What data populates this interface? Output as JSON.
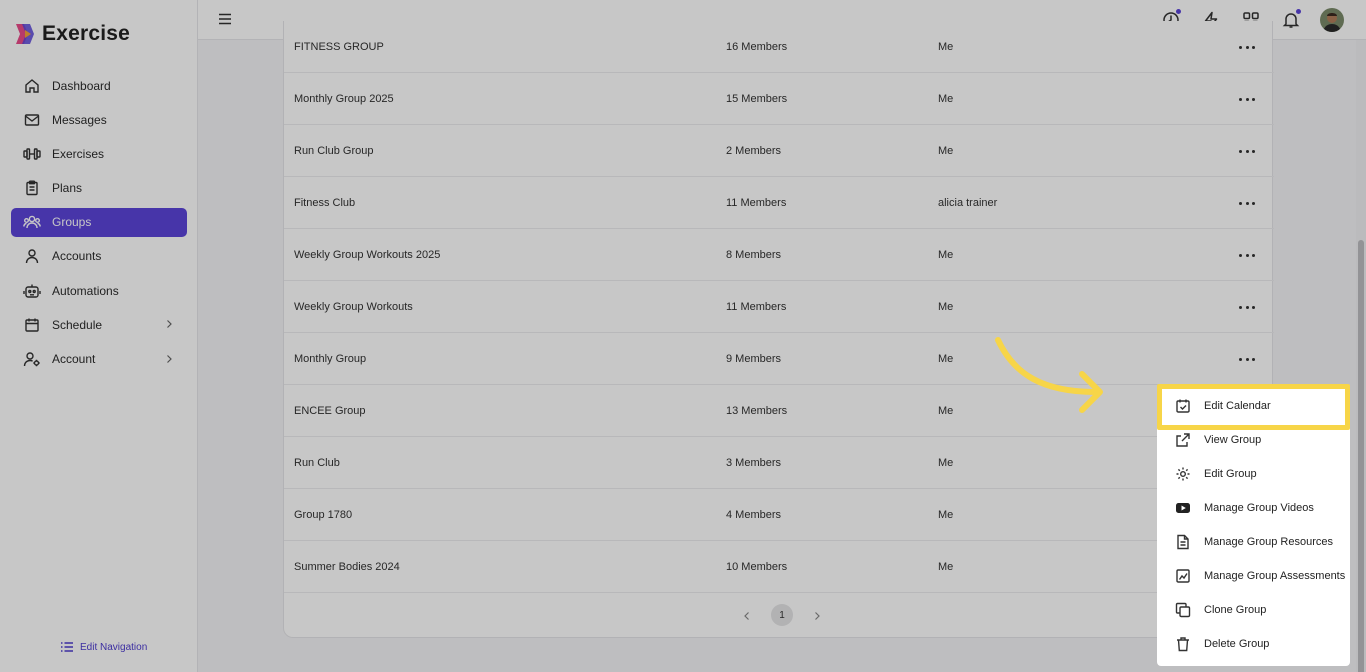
{
  "app": {
    "name": "Exercise"
  },
  "sidebar": {
    "items": [
      {
        "label": "Dashboard",
        "icon": "home-icon"
      },
      {
        "label": "Messages",
        "icon": "mail-icon"
      },
      {
        "label": "Exercises",
        "icon": "dumbbell-icon"
      },
      {
        "label": "Plans",
        "icon": "clipboard-icon"
      },
      {
        "label": "Groups",
        "icon": "users-icon",
        "active": true
      },
      {
        "label": "Accounts",
        "icon": "user-icon"
      },
      {
        "label": "Automations",
        "icon": "robot-icon"
      },
      {
        "label": "Schedule",
        "icon": "calendar-icon",
        "expandable": true
      },
      {
        "label": "Account",
        "icon": "user-gear-icon",
        "expandable": true
      }
    ],
    "edit_navigation": "Edit Navigation"
  },
  "topbar": {
    "icons": [
      "clock-icon",
      "lightning-icon",
      "grid-icon",
      "bell-icon"
    ]
  },
  "groups": {
    "rows": [
      {
        "name": "FITNESS GROUP",
        "members": "16 Members",
        "owner": "Me"
      },
      {
        "name": "Monthly Group 2025",
        "members": "15 Members",
        "owner": "Me"
      },
      {
        "name": "Run Club Group",
        "members": "2 Members",
        "owner": "Me"
      },
      {
        "name": "Fitness Club",
        "members": "11 Members",
        "owner": "alicia trainer"
      },
      {
        "name": "Weekly Group Workouts 2025",
        "members": "8 Members",
        "owner": "Me"
      },
      {
        "name": "Weekly Group Workouts",
        "members": "11 Members",
        "owner": "Me"
      },
      {
        "name": "Monthly Group",
        "members": "9 Members",
        "owner": "Me"
      },
      {
        "name": "ENCEE Group",
        "members": "13 Members",
        "owner": "Me"
      },
      {
        "name": "Run Club",
        "members": "3 Members",
        "owner": "Me"
      },
      {
        "name": "Group 1780",
        "members": "4 Members",
        "owner": "Me"
      },
      {
        "name": "Summer Bodies 2024",
        "members": "10 Members",
        "owner": "Me"
      }
    ],
    "pagination": {
      "current_page": "1"
    }
  },
  "context_menu": {
    "items": [
      {
        "label": "Edit Calendar",
        "icon": "calendar-check-icon"
      },
      {
        "label": "View Group",
        "icon": "external-link-icon"
      },
      {
        "label": "Edit Group",
        "icon": "gear-icon"
      },
      {
        "label": "Manage Group Videos",
        "icon": "youtube-icon"
      },
      {
        "label": "Manage Group Resources",
        "icon": "document-icon"
      },
      {
        "label": "Manage Group Assessments",
        "icon": "chart-edit-icon"
      },
      {
        "label": "Clone Group",
        "icon": "copy-icon"
      },
      {
        "label": "Delete Group",
        "icon": "trash-icon"
      }
    ]
  },
  "colors": {
    "accent": "#5b45d9",
    "highlight": "#f7d548"
  }
}
